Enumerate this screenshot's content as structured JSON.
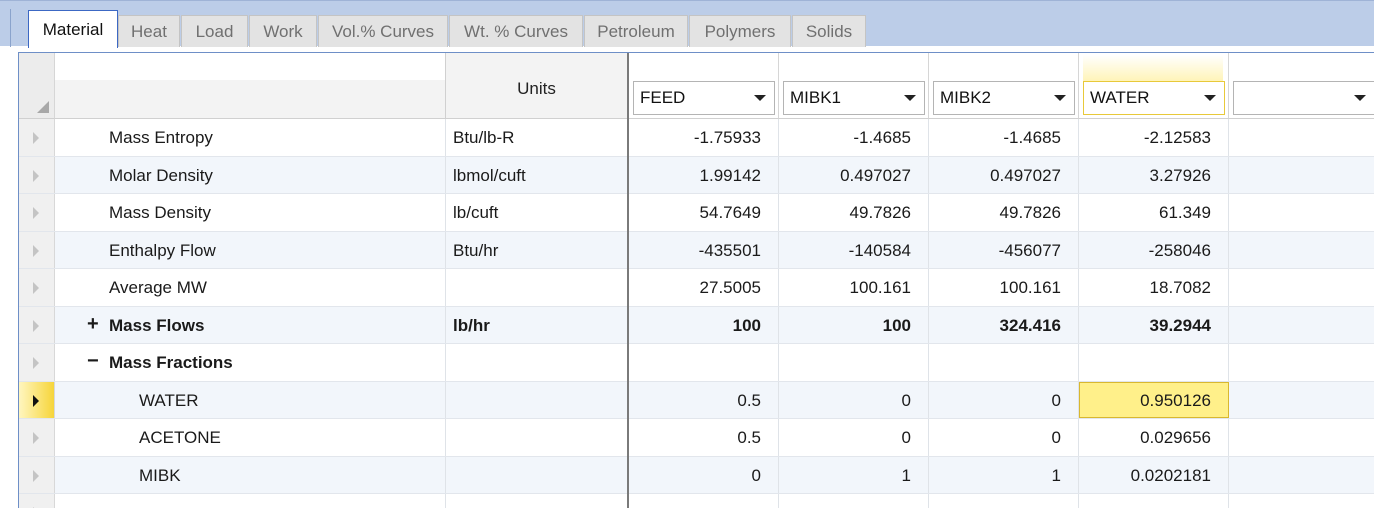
{
  "tabs": [
    {
      "label": "Material",
      "active": true
    },
    {
      "label": "Heat"
    },
    {
      "label": "Load"
    },
    {
      "label": "Work"
    },
    {
      "label": "Vol.% Curves"
    },
    {
      "label": "Wt. % Curves"
    },
    {
      "label": "Petroleum"
    },
    {
      "label": "Polymers"
    },
    {
      "label": "Solids"
    }
  ],
  "grid": {
    "units_header": "Units",
    "streams": [
      {
        "label": "FEED"
      },
      {
        "label": "MIBK1"
      },
      {
        "label": "MIBK2"
      },
      {
        "label": "WATER",
        "active": true
      },
      {
        "label": ""
      }
    ],
    "rows": [
      {
        "name": "Mass Entropy",
        "units": "Btu/lb-R",
        "values": [
          "-1.75933",
          "-1.4685",
          "-1.4685",
          "-2.12583",
          ""
        ]
      },
      {
        "name": "Molar Density",
        "units": "lbmol/cuft",
        "values": [
          "1.99142",
          "0.497027",
          "0.497027",
          "3.27926",
          ""
        ]
      },
      {
        "name": "Mass Density",
        "units": "lb/cuft",
        "values": [
          "54.7649",
          "49.7826",
          "49.7826",
          "61.349",
          ""
        ]
      },
      {
        "name": "Enthalpy Flow",
        "units": "Btu/hr",
        "values": [
          "-435501",
          "-140584",
          "-456077",
          "-258046",
          ""
        ]
      },
      {
        "name": "Average MW",
        "units": "",
        "values": [
          "27.5005",
          "100.161",
          "100.161",
          "18.7082",
          ""
        ]
      },
      {
        "name": "Mass Flows",
        "units": "lb/hr",
        "expander": "+",
        "bold": true,
        "values": [
          "100",
          "100",
          "324.416",
          "39.2944",
          ""
        ]
      },
      {
        "name": "Mass Fractions",
        "units": "",
        "expander": "−",
        "bold": true,
        "values": [
          "",
          "",
          "",
          "",
          ""
        ]
      },
      {
        "name": "WATER",
        "units": "",
        "indent": 2,
        "current": true,
        "values": [
          "0.5",
          "0",
          "0",
          "0.950126",
          ""
        ]
      },
      {
        "name": "ACETONE",
        "units": "",
        "indent": 2,
        "values": [
          "0.5",
          "0",
          "0",
          "0.029656",
          ""
        ]
      },
      {
        "name": "MIBK",
        "units": "",
        "indent": 2,
        "values": [
          "0",
          "1",
          "1",
          "0.0202181",
          ""
        ]
      },
      {
        "name": "",
        "units": "",
        "values": [
          "",
          "",
          "",
          "",
          ""
        ]
      }
    ],
    "selected_cell": {
      "row": 7,
      "col": 3
    }
  }
}
